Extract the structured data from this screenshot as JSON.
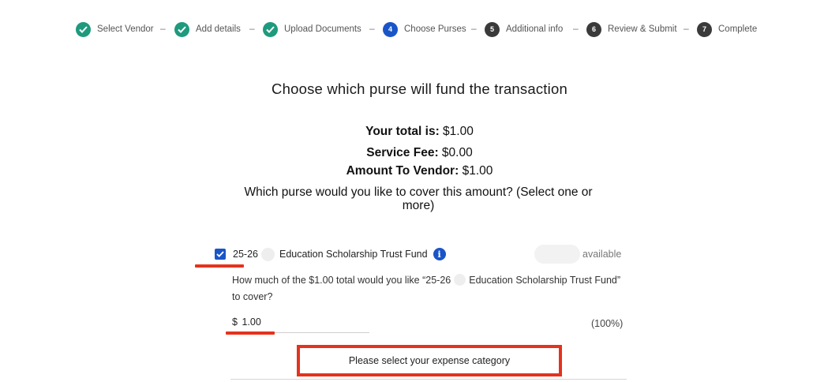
{
  "stepper": {
    "steps": [
      {
        "label": "Select Vendor",
        "state": "done",
        "number": "1"
      },
      {
        "label": "Add details",
        "state": "done",
        "number": "2"
      },
      {
        "label": "Upload Documents",
        "state": "done",
        "number": "3"
      },
      {
        "label": "Choose Purses",
        "state": "current",
        "number": "4"
      },
      {
        "label": "Additional info",
        "state": "todo",
        "number": "5"
      },
      {
        "label": "Review & Submit",
        "state": "todo",
        "number": "6"
      },
      {
        "label": "Complete",
        "state": "todo",
        "number": "7"
      }
    ],
    "separator": "–"
  },
  "page": {
    "title": "Choose which purse will fund the transaction"
  },
  "summary": {
    "total_label": "Your total is:",
    "total_value": "$1.00",
    "fee_label": "Service Fee:",
    "fee_value": "$0.00",
    "vendor_label": "Amount To Vendor:",
    "vendor_value": "$1.00",
    "question": "Which purse would you like to cover this amount? (Select one or more)"
  },
  "purse": {
    "checked": true,
    "prefix": "25-26",
    "name": "Education Scholarship Trust Fund",
    "available_label": "available",
    "cover_question_part1": "How much of the $1.00 total would you like “25-26",
    "cover_question_part2": "Education Scholarship Trust Fund” to cover?",
    "currency": "$",
    "amount": "1.00",
    "percent": "(100%)"
  },
  "expense": {
    "button_label": "Please select your expense category"
  },
  "colors": {
    "done": "#1e9a7d",
    "current": "#1a55c8",
    "todo": "#3a3a3a",
    "highlight": "#e5321d"
  },
  "icons": {
    "step_done": "check-icon",
    "info": "info-icon",
    "checkbox": "checkbox-checked-icon"
  }
}
